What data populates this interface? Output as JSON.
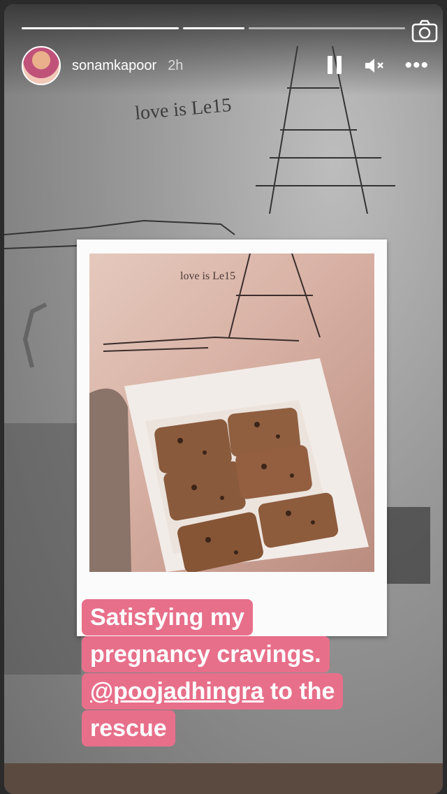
{
  "user": {
    "username": "sonamkapoor",
    "time_ago": "2h"
  },
  "icons": {
    "camera": "camera-icon",
    "pause": "pause-icon",
    "mute": "speaker-muted-icon",
    "more": "more-options-icon"
  },
  "sketch_text": "love is Le15",
  "photo_text": "love is Le15",
  "caption": {
    "line1": "Satisfying my",
    "line2": "pregnancy cravings.",
    "mention": "@poojadhingra",
    "line3_rest": " to the",
    "line4": "rescue"
  },
  "colors": {
    "caption_bg": "#e76f8a",
    "bottom_bar": "#5b4a40"
  }
}
